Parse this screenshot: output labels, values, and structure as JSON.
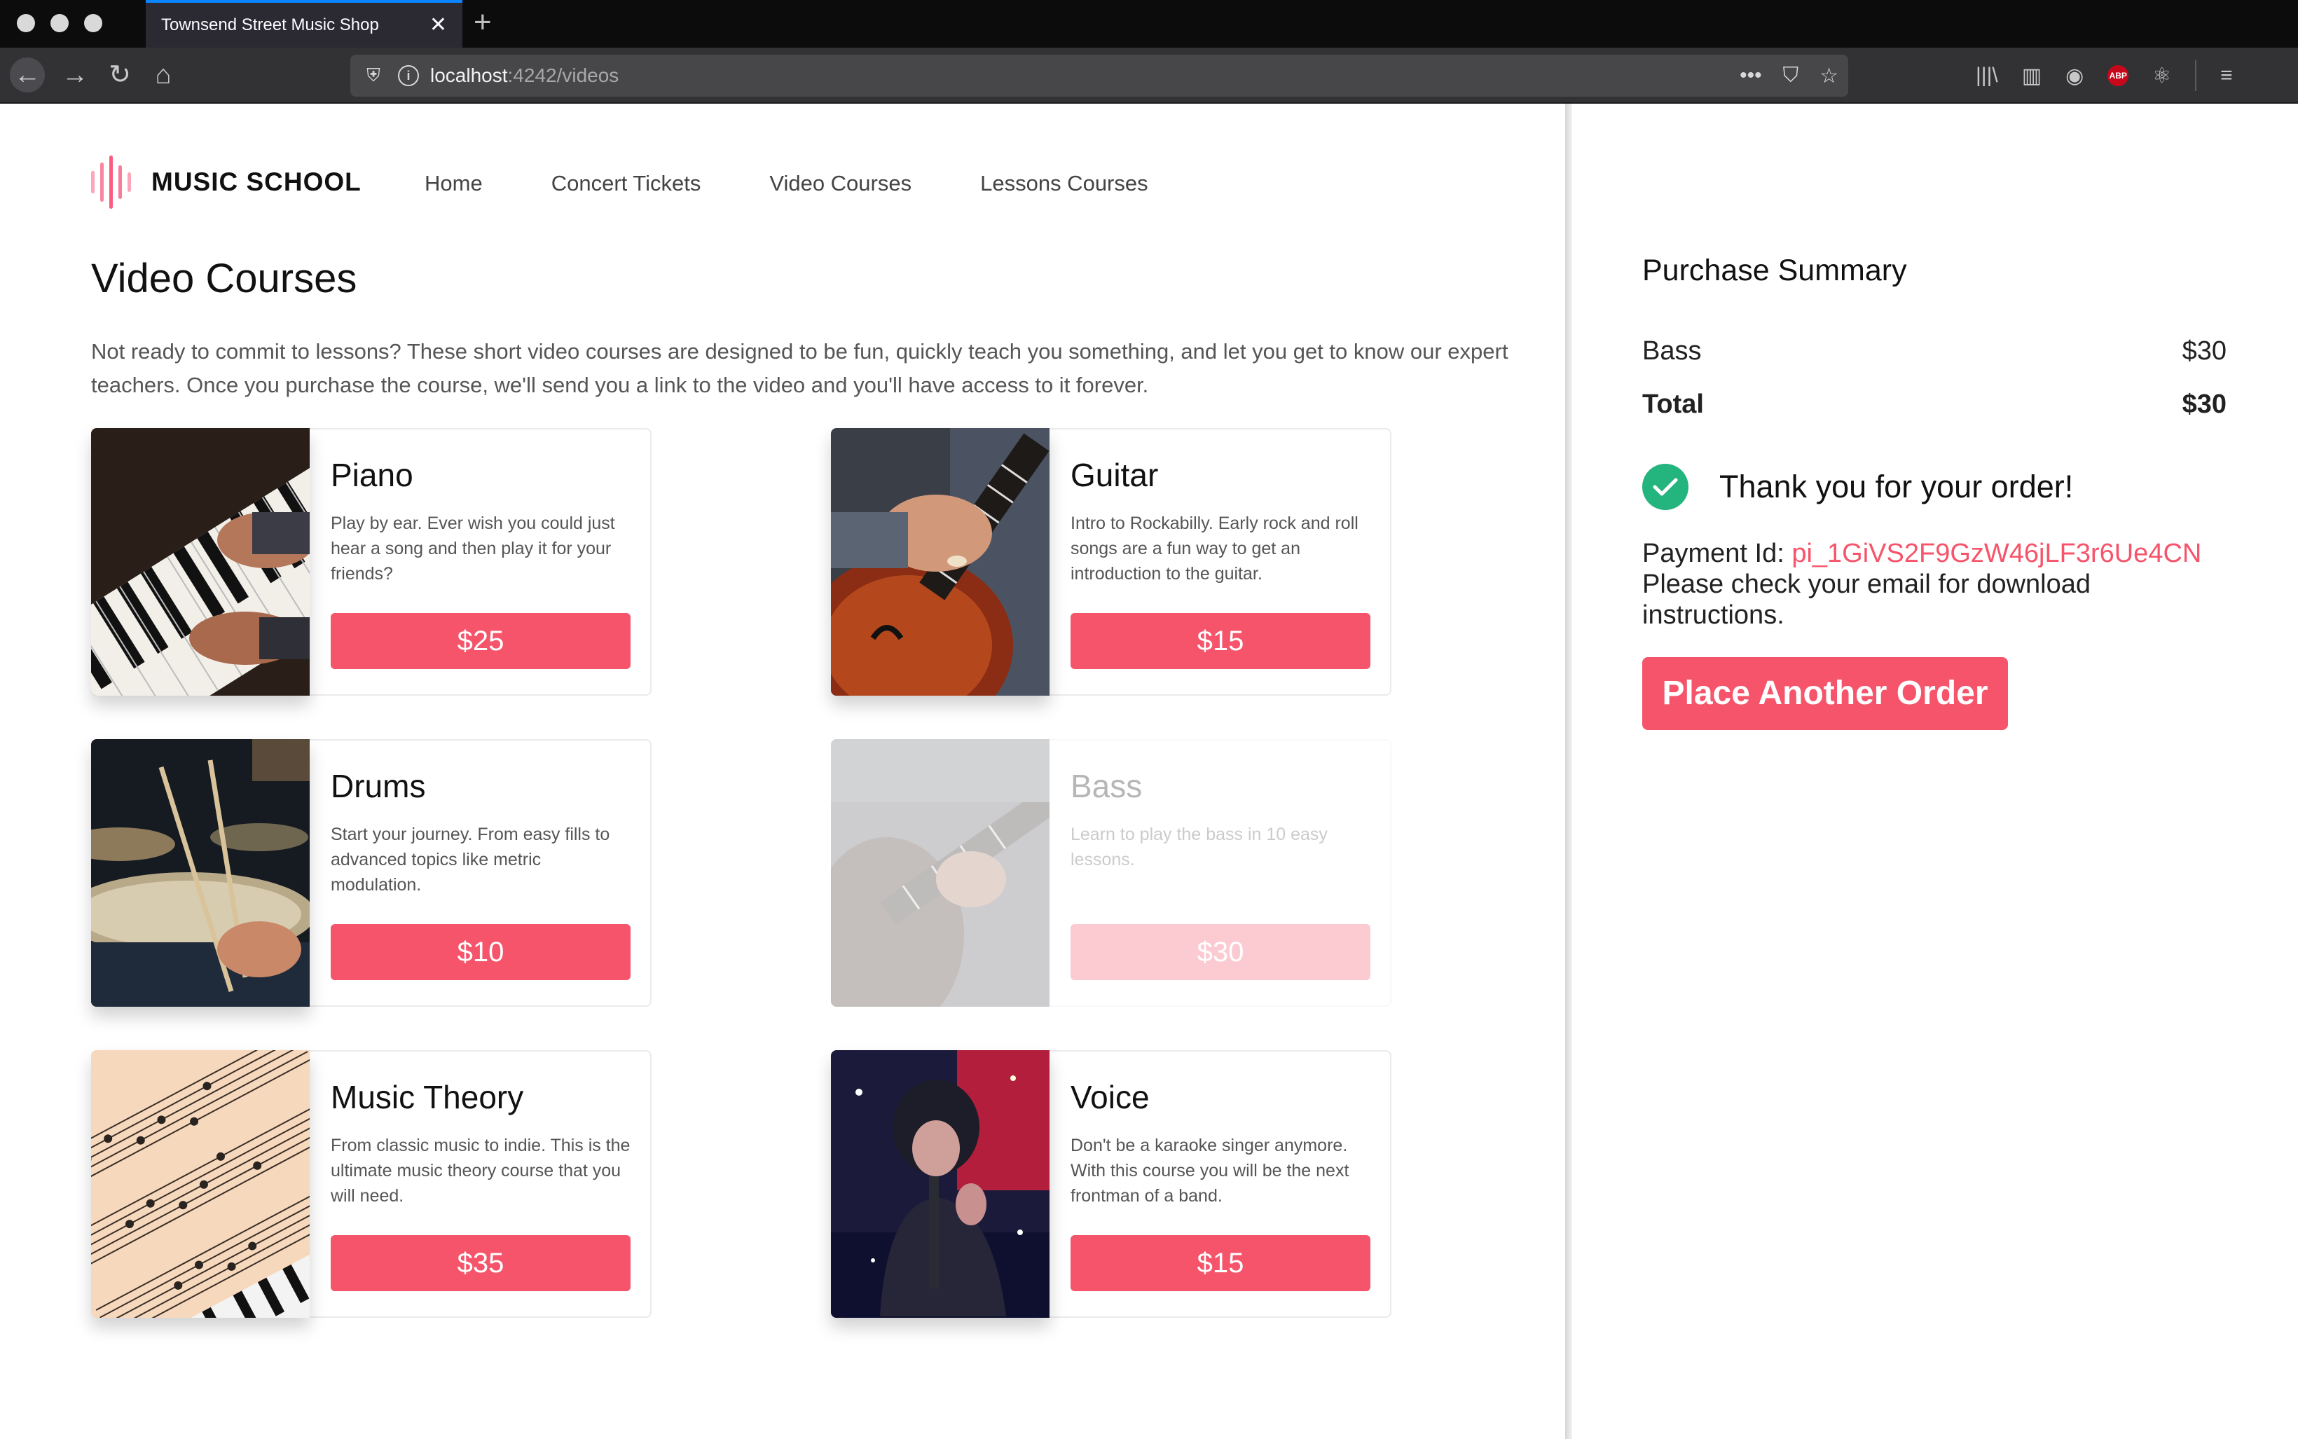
{
  "browser": {
    "tab_title": "Townsend Street Music Shop",
    "tab_close": "✕",
    "new_tab": "+",
    "url_host": "localhost",
    "url_path": ":4242/videos"
  },
  "site": {
    "logo_text": "MUSIC SCHOOL",
    "nav": [
      "Home",
      "Concert Tickets",
      "Video Courses",
      "Lessons Courses"
    ]
  },
  "page": {
    "title": "Video Courses",
    "intro": "Not ready to commit to lessons? These short video courses are designed to be fun, quickly teach you something, and let you get to know our expert teachers. Once you purchase the course, we'll send you a link to the video and you'll have access to it forever."
  },
  "courses": [
    {
      "title": "Piano",
      "description": "Play by ear. Ever wish you could just hear a song and then play it for your friends?",
      "price": "$25",
      "purchased": false,
      "image": "piano-keys"
    },
    {
      "title": "Guitar",
      "description": "Intro to Rockabilly. Early rock and roll songs are a fun way to get an introduction to the guitar.",
      "price": "$15",
      "purchased": false,
      "image": "electric-guitar"
    },
    {
      "title": "Drums",
      "description": "Start your journey. From easy fills to advanced topics like metric modulation.",
      "price": "$10",
      "purchased": false,
      "image": "drum-kit"
    },
    {
      "title": "Bass",
      "description": "Learn to play the bass in 10 easy lessons.",
      "price": "$30",
      "purchased": true,
      "image": "bass-guitar"
    },
    {
      "title": "Music Theory",
      "description": "From classic music to indie. This is the ultimate music theory course that you will need.",
      "price": "$35",
      "purchased": false,
      "image": "sheet-music"
    },
    {
      "title": "Voice",
      "description": "Don't be a karaoke singer anymore. With this course you will be the next frontman of a band.",
      "price": "$15",
      "purchased": false,
      "image": "singer"
    }
  ],
  "summary": {
    "title": "Purchase Summary",
    "item_name": "Bass",
    "item_price": "$30",
    "total_label": "Total",
    "total_value": "$30",
    "thanks": "Thank you for your order!",
    "payment_label": "Payment Id: ",
    "payment_id": "pi_1GiVS2F9GzW46jLF3r6Ue4CN",
    "instructions": "Please check your email for download instructions.",
    "again_button": "Place Another Order"
  },
  "colors": {
    "accent": "#f6546a",
    "success": "#24b47e",
    "logo": "#f85d7f"
  }
}
